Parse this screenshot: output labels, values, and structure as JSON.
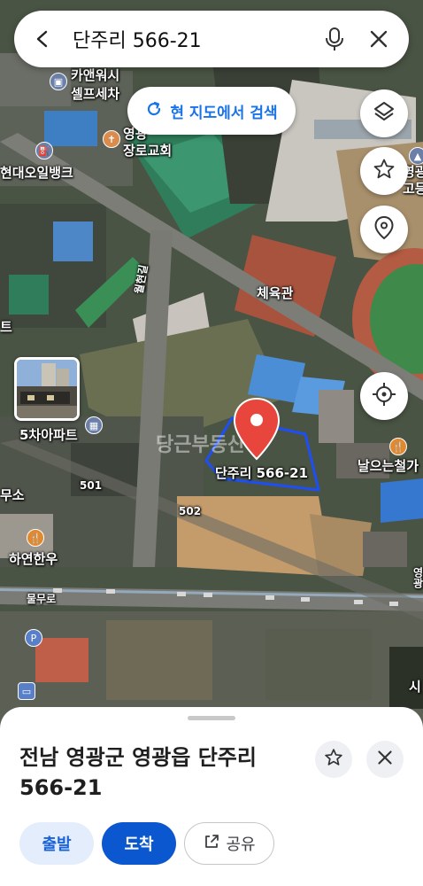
{
  "search": {
    "query": "단주리 566-21"
  },
  "area_search": {
    "label": "현 지도에서 검색"
  },
  "map_labels": {
    "carwash_1": "카앤워시",
    "carwash_2": "셀프세차",
    "church_1": "영광",
    "church_2": "장로교회",
    "bank": "현대오일뱅크",
    "school_1": "영광",
    "school_2": "고등학",
    "gym": "체육관",
    "road_vertical": "월현길",
    "park_edge": "트",
    "apartment": "5차아파트",
    "parcel": "단주리 566-21",
    "restaurant": "날으는철가",
    "office_edge": "무소",
    "addr_501": "501",
    "addr_502": "502",
    "hanwoo": "하연한우",
    "road_horizontal": "물무로",
    "right_edge_1": "영광",
    "right_edge_2": "시",
    "watermark": "당근부동산"
  },
  "place": {
    "title": "전남 영광군 영광읍 단주리 566-21"
  },
  "actions": {
    "depart": "출발",
    "arrive": "도착",
    "share": "공유"
  },
  "colors": {
    "accent_blue": "#0b57d0",
    "marker_red": "#e8453c",
    "parcel_outline": "#1d4ff5"
  }
}
